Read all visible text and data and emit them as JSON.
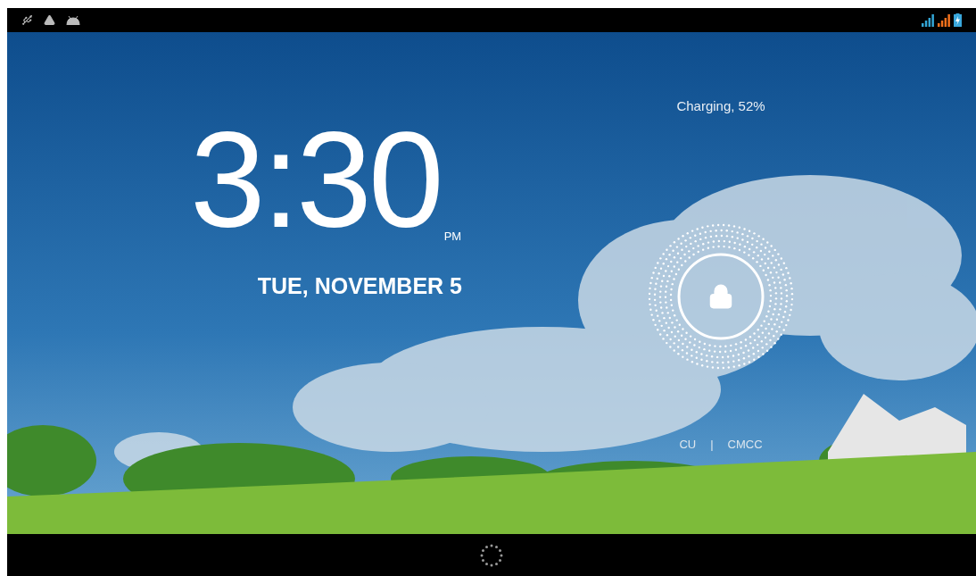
{
  "lock_screen": {
    "battery_status": "Charging, 52%",
    "time": "3:30",
    "am_pm": "PM",
    "date": "TUE, NOVEMBER 5",
    "carriers": [
      "CU",
      "CMCC"
    ],
    "carrier_separator": "|"
  }
}
